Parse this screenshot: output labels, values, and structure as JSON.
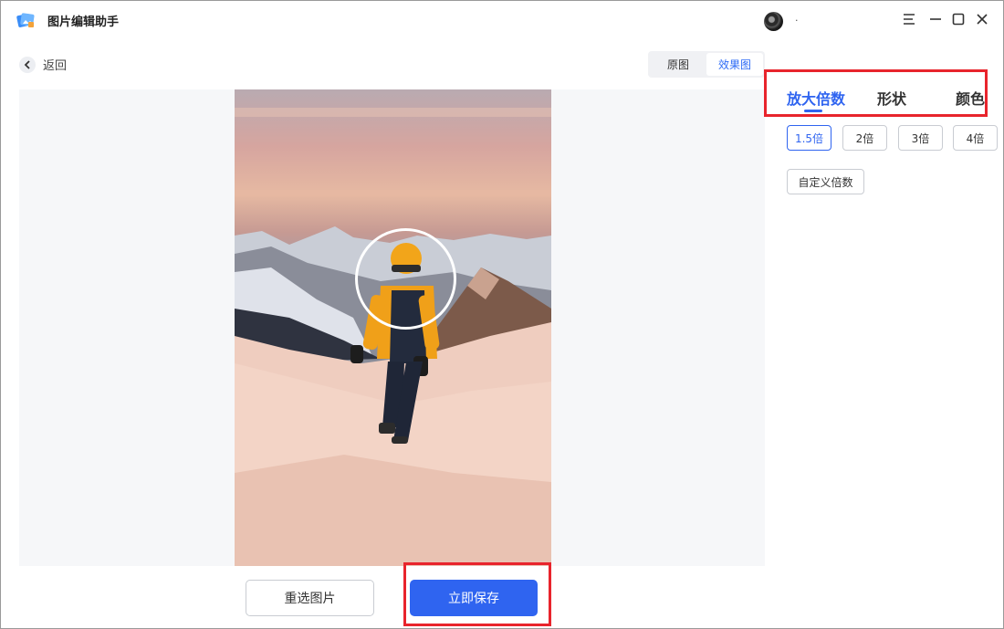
{
  "app": {
    "title": "图片编辑助手",
    "user_name": "."
  },
  "nav": {
    "back_label": "返回"
  },
  "view_toggle": {
    "original_label": "原图",
    "effect_label": "效果图",
    "active": "效果图"
  },
  "panel": {
    "tabs": [
      {
        "label": "放大倍数",
        "active": true
      },
      {
        "label": "形状",
        "active": false
      },
      {
        "label": "颜色",
        "active": false
      }
    ],
    "magnification_options": [
      {
        "label": "1.5倍",
        "selected": true
      },
      {
        "label": "2倍",
        "selected": false
      },
      {
        "label": "3倍",
        "selected": false
      },
      {
        "label": "4倍",
        "selected": false
      }
    ],
    "custom_label": "自定义倍数"
  },
  "actions": {
    "reselect_label": "重选图片",
    "save_label": "立即保存"
  },
  "colors": {
    "accent": "#2f64f0",
    "highlight": "#e8242c"
  }
}
